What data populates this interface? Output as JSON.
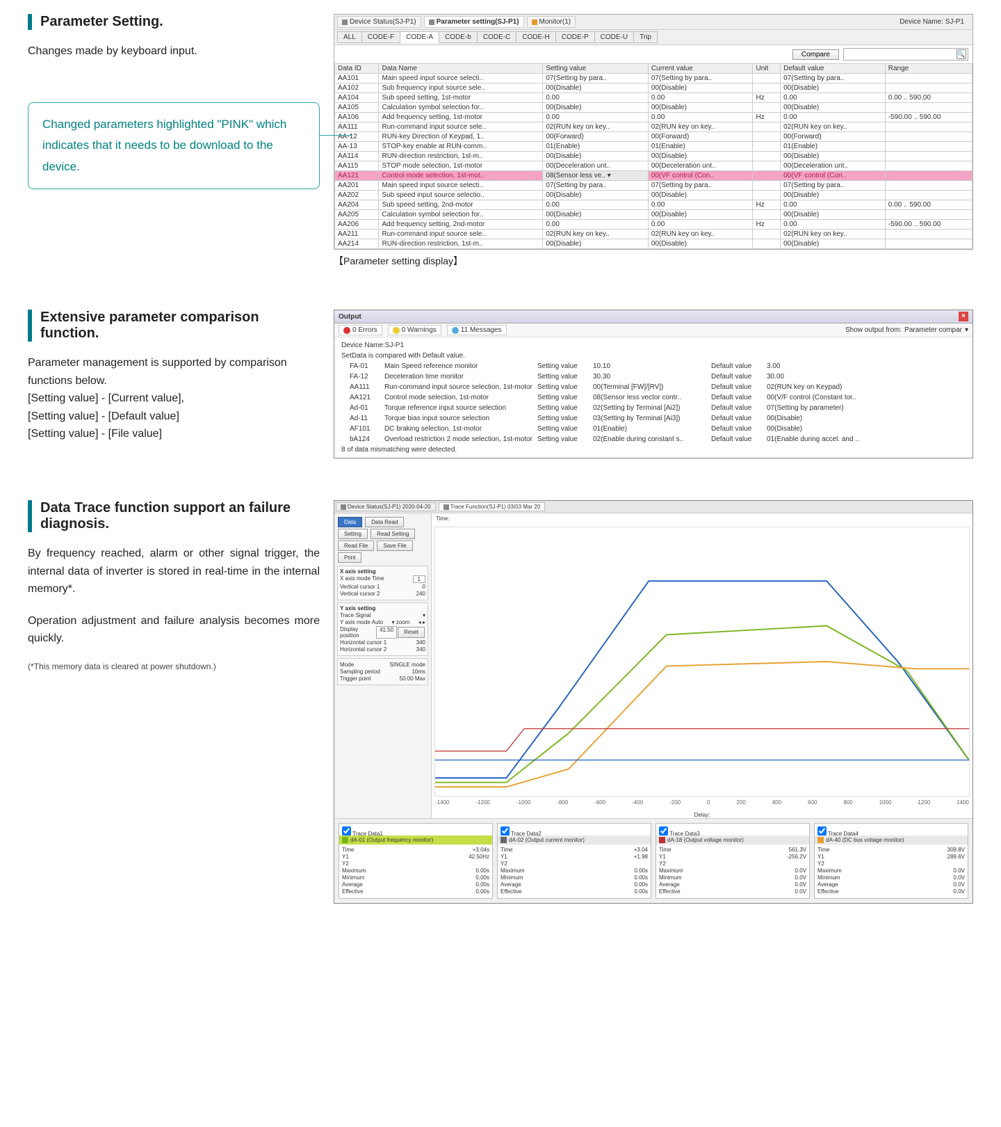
{
  "section1": {
    "heading": "Parameter Setting.",
    "body": "Changes made by keyboard input.",
    "callout": "Changed parameters highlighted \"PINK\" which indicates that it needs to be download to the device.",
    "caption": "【Parameter setting display】"
  },
  "pwin": {
    "toptabs": {
      "t1": "Device Status(SJ-P1)",
      "t2": "Parameter setting(SJ-P1)",
      "t3": "Monitor(1)"
    },
    "devlabel": "Device Name: SJ-P1",
    "codetabs": [
      "ALL",
      "CODE-F",
      "CODE-A",
      "CODE-b",
      "CODE-C",
      "CODE-H",
      "CODE-P",
      "CODE-U",
      "Trip"
    ],
    "compare": "Compare",
    "cols": {
      "c1": "Data ID",
      "c2": "Data Name",
      "c3": "Setting value",
      "c4": "Current value",
      "c5": "Unit",
      "c6": "Default value",
      "c7": "Range"
    },
    "rows": [
      {
        "id": "AA101",
        "nm": "Main speed input source selecti..",
        "sv": "07(Setting by para..",
        "cv": "07(Setting by para..",
        "un": "",
        "dv": "07(Setting by para..",
        "rg": ""
      },
      {
        "id": "AA102",
        "nm": "Sub frequency input source sele..",
        "sv": "00(Disable)",
        "cv": "00(Disable)",
        "un": "",
        "dv": "00(Disable)",
        "rg": ""
      },
      {
        "id": "AA104",
        "nm": "Sub speed setting, 1st-motor",
        "sv": "0.00",
        "cv": "0.00",
        "un": "Hz",
        "dv": "0.00",
        "rg": "0.00 .. 590.00"
      },
      {
        "id": "AA105",
        "nm": "Calculation symbol selection for..",
        "sv": "00(Disable)",
        "cv": "00(Disable)",
        "un": "",
        "dv": "00(Disable)",
        "rg": ""
      },
      {
        "id": "AA106",
        "nm": "Add frequency setting, 1st-motor",
        "sv": "0.00",
        "cv": "0.00",
        "un": "Hz",
        "dv": "0.00",
        "rg": "-590.00 .. 590.00"
      },
      {
        "id": "AA111",
        "nm": "Run-command input source sele..",
        "sv": "02(RUN key on key..",
        "cv": "02(RUN key on key..",
        "un": "",
        "dv": "02(RUN key on key..",
        "rg": ""
      },
      {
        "id": "AA-12",
        "nm": "RUN-key Direction of Keypad, 1..",
        "sv": "00(Forward)",
        "cv": "00(Forward)",
        "un": "",
        "dv": "00(Forward)",
        "rg": ""
      },
      {
        "id": "AA-13",
        "nm": "STOP-key enable at RUN-comm..",
        "sv": "01(Enable)",
        "cv": "01(Enable)",
        "un": "",
        "dv": "01(Enable)",
        "rg": ""
      },
      {
        "id": "AA114",
        "nm": "RUN-direction restriction, 1st-m..",
        "sv": "00(Disable)",
        "cv": "00(Disable)",
        "un": "",
        "dv": "00(Disable)",
        "rg": ""
      },
      {
        "id": "AA115",
        "nm": "STOP mode selection, 1st-motor",
        "sv": "00(Deceleration unt..",
        "cv": "00(Deceleration unt..",
        "un": "",
        "dv": "00(Deceleration unt..",
        "rg": ""
      },
      {
        "id": "AA121",
        "nm": "Control mode selection, 1st-mot..",
        "sv": "08(Sensor less ve.. ▾",
        "cv": "00(VF control (Con..",
        "un": "",
        "dv": "00(VF control (Con..",
        "rg": "",
        "pink": true
      },
      {
        "id": "AA201",
        "nm": "Main speed input source selecti..",
        "sv": "07(Setting by para..",
        "cv": "07(Setting by para..",
        "un": "",
        "dv": "07(Setting by para..",
        "rg": ""
      },
      {
        "id": "AA202",
        "nm": "Sub speed input source selectio..",
        "sv": "00(Disable)",
        "cv": "00(Disable)",
        "un": "",
        "dv": "00(Disable)",
        "rg": ""
      },
      {
        "id": "AA204",
        "nm": "Sub speed setting, 2nd-motor",
        "sv": "0.00",
        "cv": "0.00",
        "un": "Hz",
        "dv": "0.00",
        "rg": "0.00 .. 590.00"
      },
      {
        "id": "AA205",
        "nm": "Calculation symbol selection for..",
        "sv": "00(Disable)",
        "cv": "00(Disable)",
        "un": "",
        "dv": "00(Disable)",
        "rg": ""
      },
      {
        "id": "AA206",
        "nm": "Add frequency setting, 2nd-motor",
        "sv": "0.00",
        "cv": "0.00",
        "un": "Hz",
        "dv": "0.00",
        "rg": "-590.00 .. 590.00"
      },
      {
        "id": "AA211",
        "nm": "Run-command input source sele..",
        "sv": "02(RUN key on key..",
        "cv": "02(RUN key on key..",
        "un": "",
        "dv": "02(RUN key on key..",
        "rg": ""
      },
      {
        "id": "AA214",
        "nm": "RUN-direction restriction, 1st-m..",
        "sv": "00(Disable)",
        "cv": "00(Disable)",
        "un": "",
        "dv": "00(Disable)",
        "rg": ""
      }
    ]
  },
  "section2": {
    "heading": "Extensive parameter comparison function.",
    "body1": "Parameter management is supported by comparison functions below.",
    "body2": "[Setting value] - [Current value],",
    "body3": "[Setting value] - [Default value]",
    "body4": "[Setting value] - [File value]"
  },
  "owin": {
    "title": "Output",
    "err": "0 Errors",
    "warn": "0 Warnings",
    "msg": "11 Messages",
    "showlabel": "Show output from:",
    "source": "Parameter compar",
    "chev": "▾",
    "l1": "Device Name:SJ-P1",
    "l2": "SetData is compared with Default value.",
    "rows": [
      {
        "id": "FA-01",
        "nm": "Main Speed reference monitor",
        "sl": "Setting value",
        "sv": "10.10",
        "dl": "Default value",
        "dv": "3.00"
      },
      {
        "id": "FA-12",
        "nm": "Deceleration time monitor",
        "sl": "Setting value",
        "sv": "30.30",
        "dl": "Default value",
        "dv": "30.00"
      },
      {
        "id": "AA111",
        "nm": "Run-command input source selection, 1st-motor",
        "sl": "Setting value",
        "sv": "00(Terminal [FW]/[RV])",
        "dl": "Default value",
        "dv": "02(RUN key on Keypad)"
      },
      {
        "id": "AA121",
        "nm": "Control mode selection, 1st-motor",
        "sl": "Setting value",
        "sv": "08(Sensor less vector contr..",
        "dl": "Default value",
        "dv": "00(V/F control (Constant tor.."
      },
      {
        "id": "Ad-01",
        "nm": "Torque reference input source selection",
        "sl": "Setting value",
        "sv": "02(Setting by Terminal [Ai2])",
        "dl": "Default value",
        "dv": "07(Setting by parameter)"
      },
      {
        "id": "Ad-11",
        "nm": "Torque bias input source selection",
        "sl": "Setting value",
        "sv": "03(Setting by Terminal [Ai3])",
        "dl": "Default value",
        "dv": "00(Disable)"
      },
      {
        "id": "AF101",
        "nm": "DC braking selection, 1st-motor",
        "sl": "Setting value",
        "sv": "01(Enable)",
        "dl": "Default value",
        "dv": "00(Disable)"
      },
      {
        "id": "bA124",
        "nm": "Overload restriction 2 mode selection, 1st-motor",
        "sl": "Setting value",
        "sv": "02(Enable during constant s..",
        "dl": "Default value",
        "dv": "01(Enable during accel. and .."
      }
    ],
    "foot": "8 of data mismatching were detected."
  },
  "section3": {
    "heading": "Data Trace function support an failure diagnosis.",
    "body1": "By frequency reached, alarm or other signal trigger, the internal data of inverter is stored in real-time in the internal memory*.",
    "body2": "Operation adjustment and failure analysis becomes more quickly.",
    "foot": "(*This memory data is cleared at power shutdown.)"
  },
  "trace": {
    "tabs": {
      "t1": "Device Status(SJ-P1) 2020-04-20",
      "t2": "Trace Function(SJ-P1) 03/03 Mar 20"
    },
    "btns": {
      "data": "Data",
      "dataread": "Data Read",
      "setting": "Setting",
      "readset": "Read Setting",
      "readfile": "Read File",
      "savefile": "Save File",
      "print": "Print"
    },
    "group1": {
      "title": "X axis setting",
      "l1": "X axis mode Time",
      "v1": "1",
      "l2": "Vertical cursor 1",
      "v2": "0",
      "l3": "Vertical cursor 2",
      "v3": "240"
    },
    "group2": {
      "title": "Y axis setting",
      "l1": "Trace Signal",
      "l2": "Y axis mode Auto",
      "l3": "▾ zoom",
      "l4": "◂ ▸",
      "l5": "Display position",
      "v5": "41.50",
      "btn": "Reset",
      "l6": "Horizontal cursor 1",
      "v6": "340",
      "l7": "Horizontal cursor 2",
      "v7": "340"
    },
    "group3": {
      "l1": "Mode",
      "v1": "SINGLE mode",
      "l2": "Sampling period",
      "v2": "10ms",
      "l3": "Trigger point",
      "v3": "50.00 Max"
    },
    "xaxis": [
      "-1400",
      "-1200",
      "-1000",
      "-800",
      "-600",
      "-400",
      "-200",
      "0",
      "200",
      "400",
      "600",
      "800",
      "1000",
      "1200",
      "1400"
    ],
    "xlabel": "Delay:",
    "panels": {
      "p1": {
        "chk": "Trace Data1",
        "sq": "#7ab51d",
        "title": "dA-01 (Output frequency monitor)",
        "r": [
          [
            "Time",
            "+3.04s"
          ],
          [
            "Y1",
            "42.50Hz"
          ],
          [
            "Y2",
            ""
          ],
          [
            "Maximum",
            "0.00s"
          ],
          [
            "Minimum",
            "0.00s"
          ],
          [
            "Average",
            "0.00s"
          ],
          [
            "Effective",
            "0.00s"
          ]
        ]
      },
      "p2": {
        "chk": "Trace Data2",
        "sq": "#666",
        "title": "dA-02 (Output current monitor)",
        "r": [
          [
            "Time",
            "+3.04"
          ],
          [
            "Y1",
            "+1.98"
          ],
          [
            "Y2",
            ""
          ],
          [
            "Maximum",
            "0.00s"
          ],
          [
            "Minimum",
            "0.00s"
          ],
          [
            "Average",
            "0.00s"
          ],
          [
            "Effective",
            "0.00s"
          ]
        ]
      },
      "p3": {
        "chk": "Trace Data3",
        "sq": "#c03030",
        "title": "dA-18 (Output voltage monitor)",
        "r": [
          [
            "Time",
            "561.3V"
          ],
          [
            "Y1",
            "-256.2V"
          ],
          [
            "Y2",
            ""
          ],
          [
            "Maximum",
            "0.0V"
          ],
          [
            "Minimum",
            "0.0V"
          ],
          [
            "Average",
            "0.0V"
          ],
          [
            "Effective",
            "0.0V"
          ]
        ]
      },
      "p4": {
        "chk": "Trace Data4",
        "sq": "#e8a030",
        "title": "dA-40 (DC bus voltage monitor)",
        "r": [
          [
            "Time",
            "309.8V"
          ],
          [
            "Y1",
            "289.6V"
          ],
          [
            "Y2",
            ""
          ],
          [
            "Maximum",
            "0.0V"
          ],
          [
            "Minimum",
            "0.0V"
          ],
          [
            "Average",
            "0.0V"
          ],
          [
            "Effective",
            "0.0V"
          ]
        ]
      }
    }
  }
}
